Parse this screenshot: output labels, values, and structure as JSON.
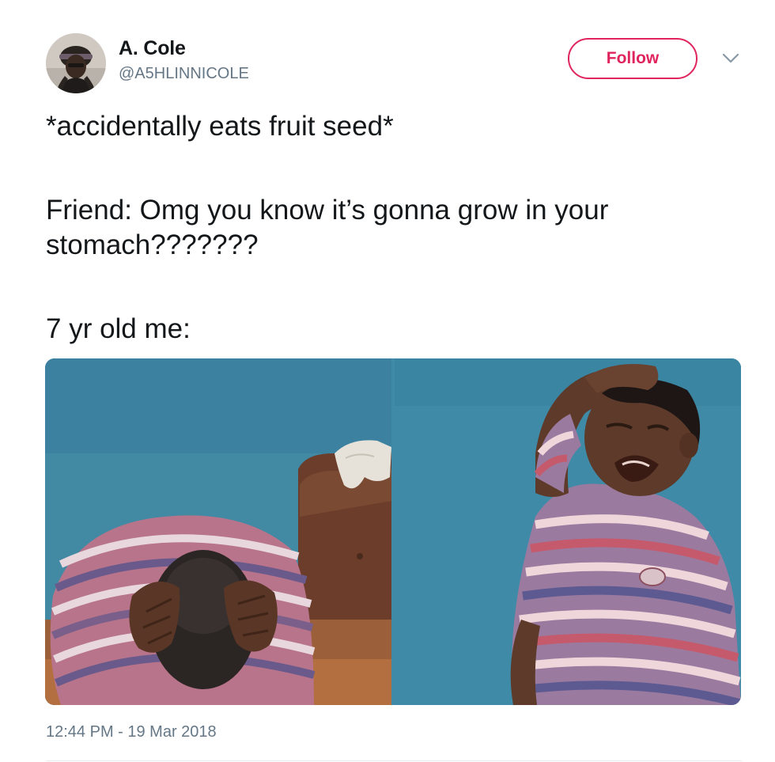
{
  "author": {
    "name": "A. Cole",
    "handle": "@A5HLINNICOLE"
  },
  "actions": {
    "follow_label": "Follow",
    "menu_icon": "chevron-down-icon"
  },
  "tweet": {
    "line1": "*accidentally eats fruit seed*",
    "line2": "Friend: Omg you know it’s gonna grow in your stomach???????",
    "line3": "7 yr old me:"
  },
  "timestamp": "12:44 PM - 19 Mar 2018",
  "colors": {
    "follow_accent": "#e0245e",
    "secondary_text": "#657786",
    "primary_text": "#14171a",
    "photo_wall": "#3f8aa6"
  }
}
